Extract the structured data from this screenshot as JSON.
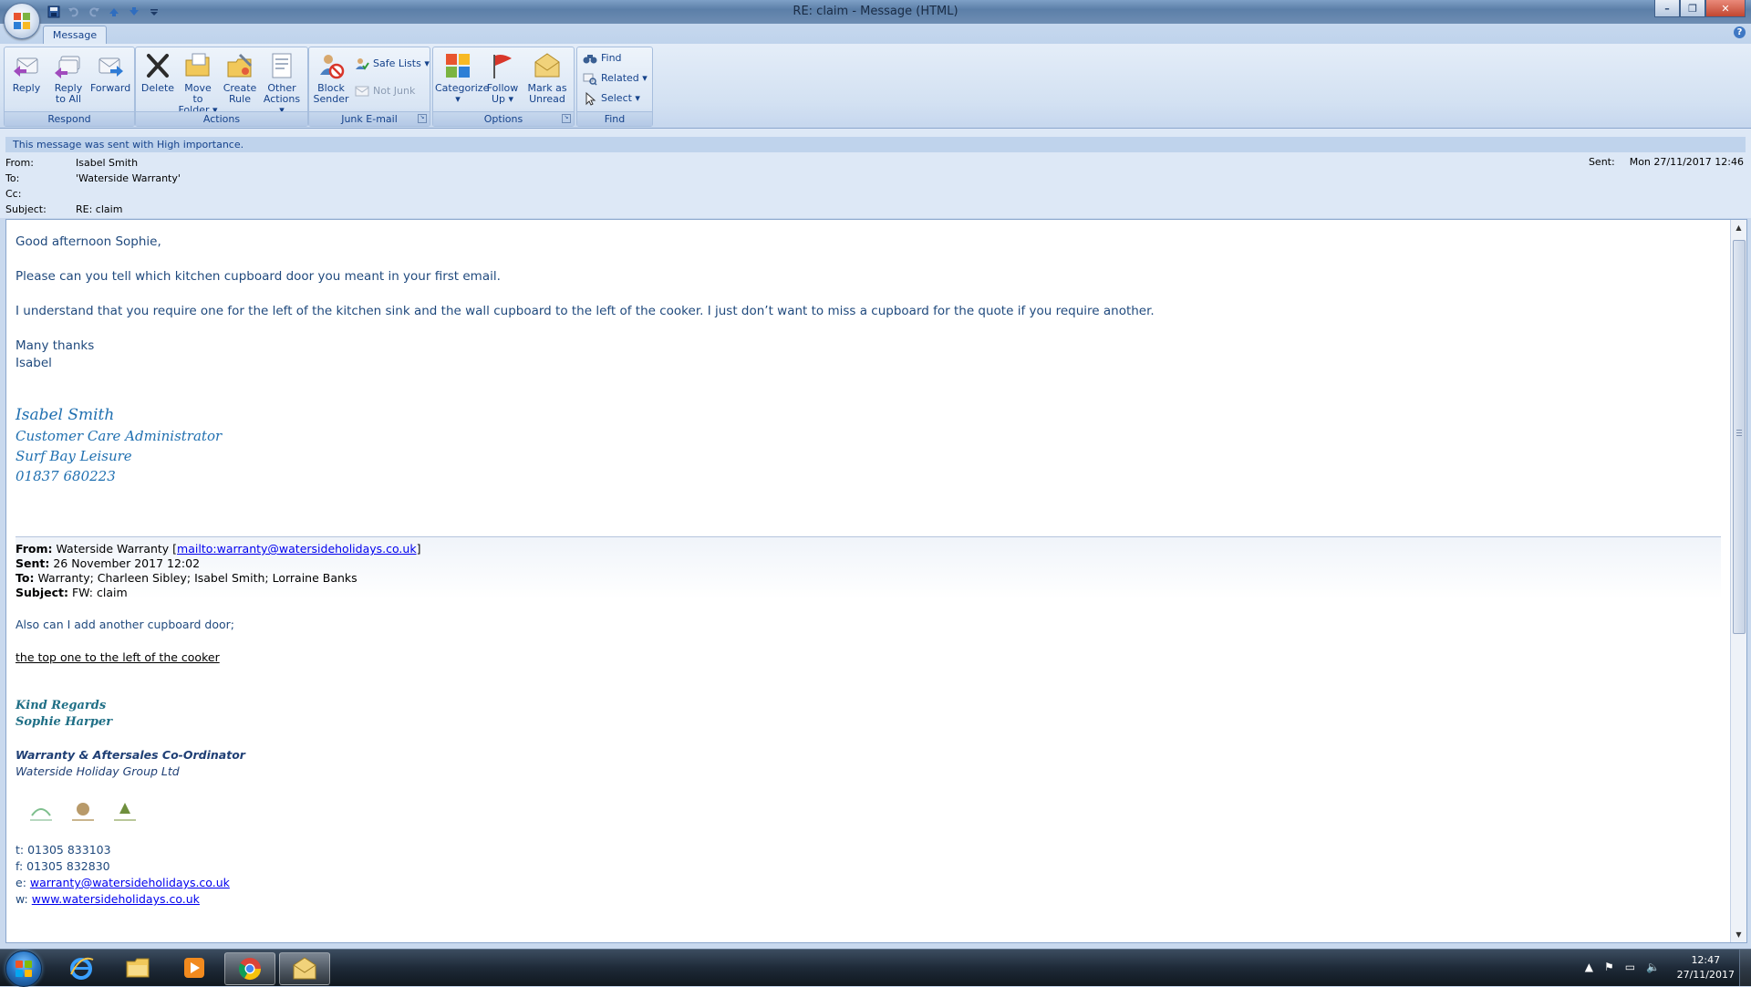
{
  "window": {
    "title": "RE: claim - Message (HTML)",
    "controls": {
      "minimize": "–",
      "restore": "❐",
      "close": "✕"
    }
  },
  "qat_icons": [
    "save-icon",
    "undo-icon",
    "redo-icon",
    "previous-item-icon",
    "next-item-icon",
    "customize-icon"
  ],
  "ribbon": {
    "tab": "Message",
    "help": "?",
    "groups": {
      "respond": {
        "label": "Respond",
        "reply": "Reply",
        "reply_all": "Reply\nto All",
        "forward": "Forward"
      },
      "actions": {
        "label": "Actions",
        "delete": "Delete",
        "move_to_folder": "Move to\nFolder ▾",
        "create_rule": "Create\nRule",
        "other_actions": "Other\nActions ▾"
      },
      "junk": {
        "label": "Junk E-mail",
        "block_sender": "Block\nSender",
        "safe_lists": "Safe Lists ▾",
        "not_junk": "Not Junk"
      },
      "options": {
        "label": "Options",
        "categorize": "Categorize\n▾",
        "follow_up": "Follow\nUp ▾",
        "mark_unread": "Mark as\nUnread"
      },
      "find": {
        "label": "Find",
        "find": "Find",
        "related": "Related ▾",
        "select": "Select ▾"
      }
    }
  },
  "header": {
    "importance": "This message was sent with High importance.",
    "from_label": "From:",
    "from": "Isabel Smith",
    "to_label": "To:",
    "to": "'Waterside Warranty'",
    "cc_label": "Cc:",
    "cc": "",
    "subject_label": "Subject:",
    "subject": "RE: claim",
    "sent_label": "Sent:",
    "sent": "Mon 27/11/2017 12:46"
  },
  "body": {
    "greeting": "Good afternoon Sophie,",
    "para1": "Please can you tell which kitchen cupboard door you meant in your first email.",
    "para2": "I understand that you require one for the left of the kitchen sink and the wall cupboard to the left of the cooker. I just don’t want to miss a cupboard for the quote if you require another.",
    "closing": "Many thanks",
    "name": "Isabel",
    "signature": {
      "name": "Isabel Smith",
      "title": "Customer Care Administrator",
      "company": "Surf Bay Leisure",
      "phone": "01837 680223"
    }
  },
  "original": {
    "from_label": "From:",
    "from_name": "Waterside Warranty [",
    "from_link": "mailto:warranty@watersideholidays.co.uk",
    "from_end": "]",
    "sent_label": "Sent:",
    "sent": "26 November 2017 12:02",
    "to_label": "To:",
    "to": "Warranty; Charleen Sibley; Isabel Smith; Lorraine Banks",
    "subject_label": "Subject:",
    "subject": "FW: claim",
    "line1": "Also can I add another cupboard door;",
    "line2": "the top one to the left of the cooker",
    "regards": "Kind Regards",
    "sender": "Sophie Harper",
    "role": "Warranty & Aftersales Co-Ordinator",
    "company": "Waterside Holiday Group Ltd",
    "tel_label": "t:",
    "tel": "01305 833103",
    "fax_label": "f:",
    "fax": "01305 832830",
    "email_label": "e:",
    "email": "warranty@watersideholidays.co.uk",
    "web_label": "w:",
    "web": "www.watersideholidays.co.uk"
  },
  "taskbar": {
    "time": "12:47",
    "date": "27/11/2017"
  },
  "colors": {
    "ribbon_text": "#15428b",
    "body_text": "#1f497d",
    "signature": "#1f6fb0",
    "link": "#0000ee"
  }
}
